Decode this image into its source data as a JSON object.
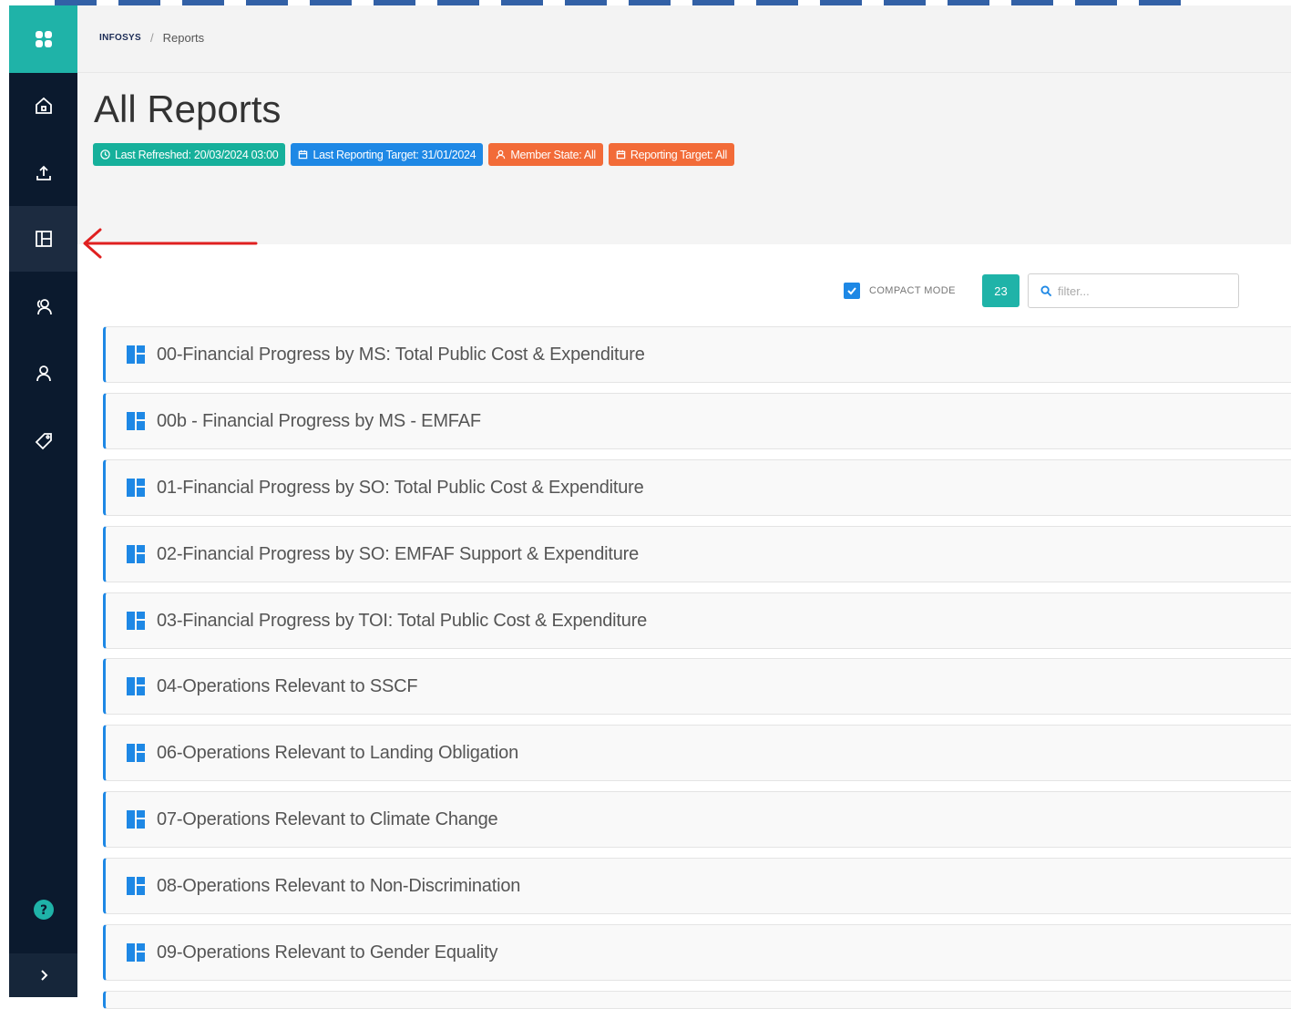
{
  "breadcrumb": {
    "brand": "INFOSYS",
    "separator": "/",
    "current": "Reports"
  },
  "page": {
    "title": "All Reports"
  },
  "badges": [
    {
      "label": "Last Refreshed: 20/03/2024 03:00",
      "icon": "clock-icon",
      "color": "#16b09b"
    },
    {
      "label": "Last Reporting Target: 31/01/2024",
      "icon": "calendar-icon",
      "color": "#1e88e5"
    },
    {
      "label": "Member State: All",
      "icon": "user-icon",
      "color": "#f26b38"
    },
    {
      "label": "Reporting Target: All",
      "icon": "calendar-icon",
      "color": "#f26b38"
    }
  ],
  "sidebar": {
    "logo_icon": "apps-grid-icon",
    "items": [
      {
        "icon": "home-icon",
        "active": false
      },
      {
        "icon": "upload-icon",
        "active": false
      },
      {
        "icon": "dashboard-layout-icon",
        "active": true
      },
      {
        "icon": "users-group-icon",
        "active": false
      },
      {
        "icon": "user-icon",
        "active": false
      },
      {
        "icon": "tags-icon",
        "active": false
      }
    ],
    "help_icon": "help-circle-icon",
    "expand_icon": "chevron-right-icon"
  },
  "controls": {
    "compact_mode_label": "COMPACT MODE",
    "compact_mode_checked": true,
    "report_count": "23",
    "filter_placeholder": "filter..."
  },
  "colors": {
    "accent_teal": "#1fb3a8",
    "accent_blue": "#1e88e5",
    "sidebar_bg": "#0b1a2e",
    "arrow_red": "#e02020"
  },
  "reports": [
    {
      "label": "00-Financial Progress by MS: Total Public Cost & Expenditure"
    },
    {
      "label": "00b - Financial Progress by MS - EMFAF"
    },
    {
      "label": "01-Financial Progress by SO: Total Public Cost & Expenditure"
    },
    {
      "label": "02-Financial Progress by SO: EMFAF Support & Expenditure"
    },
    {
      "label": "03-Financial Progress by TOI: Total Public Cost & Expenditure"
    },
    {
      "label": "04-Operations Relevant to SSCF"
    },
    {
      "label": "06-Operations Relevant to Landing Obligation"
    },
    {
      "label": "07-Operations Relevant to Climate Change"
    },
    {
      "label": "08-Operations Relevant to Non-Discrimination"
    },
    {
      "label": "09-Operations Relevant to Gender Equality"
    }
  ]
}
